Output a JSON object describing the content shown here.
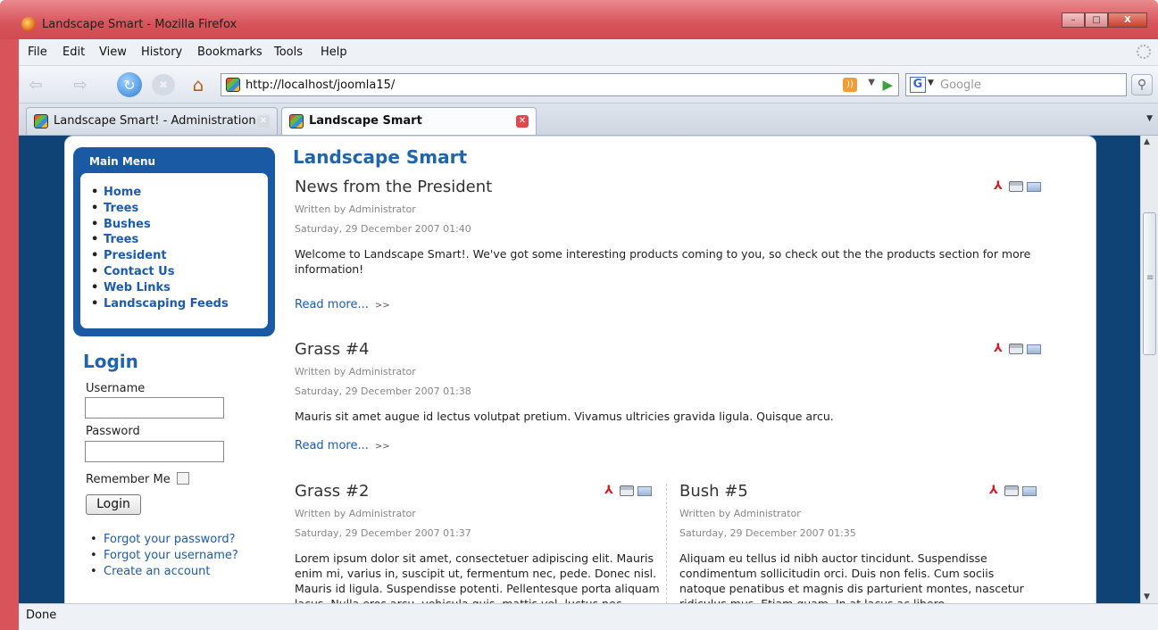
{
  "window": {
    "title": "Landscape Smart - Mozilla Firefox",
    "minimize": "–",
    "maximize": "□",
    "close": "X"
  },
  "menu": [
    "File",
    "Edit",
    "View",
    "History",
    "Bookmarks",
    "Tools",
    "Help"
  ],
  "nav": {
    "back": "⇦",
    "forward": "⇨",
    "reload": "↻",
    "stop": "✖",
    "home": "⌂",
    "url": "http://localhost/joomla15/",
    "go": "▶"
  },
  "search": {
    "engine": "G",
    "placeholder": "Google",
    "button": "⚲"
  },
  "tabs": [
    {
      "label": "Landscape Smart! - Administration",
      "active": false
    },
    {
      "label": "Landscape Smart",
      "active": true
    }
  ],
  "sidebar": {
    "main_menu_title": "Main Menu",
    "menu_items": [
      "Home",
      "Trees",
      "Bushes",
      "Trees",
      "President",
      "Contact Us",
      "Web Links",
      "Landscaping Feeds"
    ],
    "login": {
      "title": "Login",
      "username_label": "Username",
      "password_label": "Password",
      "remember_label": "Remember Me",
      "button": "Login",
      "links": [
        "Forgot your password?",
        "Forgot your username?",
        "Create an account"
      ]
    }
  },
  "content": {
    "site_title": "Landscape Smart",
    "read_more": "Read more...",
    "arrows": ">>",
    "articles": [
      {
        "title": "News from the President",
        "author": "Written by Administrator",
        "date": "Saturday, 29 December 2007 01:40",
        "text": "Welcome to Landscape Smart!. We've got some interesting products coming to you, so check out the the products section for more information!"
      },
      {
        "title": "Grass #4",
        "author": "Written by Administrator",
        "date": "Saturday, 29 December 2007 01:38",
        "text": "Mauris sit amet augue id lectus volutpat pretium. Vivamus ultricies gravida ligula. Quisque arcu."
      },
      {
        "title": "Grass #2",
        "author": "Written by Administrator",
        "date": "Saturday, 29 December 2007 01:37",
        "text": "Lorem ipsum dolor sit amet, consectetuer adipiscing elit. Mauris enim mi, varius in, suscipit ut, fermentum nec, pede. Donec nisl. Mauris id ligula. Suspendisse potenti. Pellentesque porta aliquam lacus. Nulla eros arcu, vehicula quis, mattis vel, luctus nec, massa. Nunc vel"
      },
      {
        "title": "Bush #5",
        "author": "Written by Administrator",
        "date": "Saturday, 29 December 2007 01:35",
        "text": "Aliquam eu tellus id nibh auctor tincidunt. Suspendisse condimentum sollicitudin orci. Duis non felis. Cum sociis natoque penatibus et magnis dis parturient montes, nascetur ridiculus mus. Etiam quam. In at lacus ac libero"
      }
    ],
    "icons": {
      "pdf": "✈",
      "print": "print-icon",
      "email": "email-icon"
    }
  },
  "status": "Done",
  "colors": {
    "titlebar": "#d8545b",
    "page_bg": "#0f4275",
    "menu_box": "#1a59a3",
    "link": "#1c5bb0"
  }
}
